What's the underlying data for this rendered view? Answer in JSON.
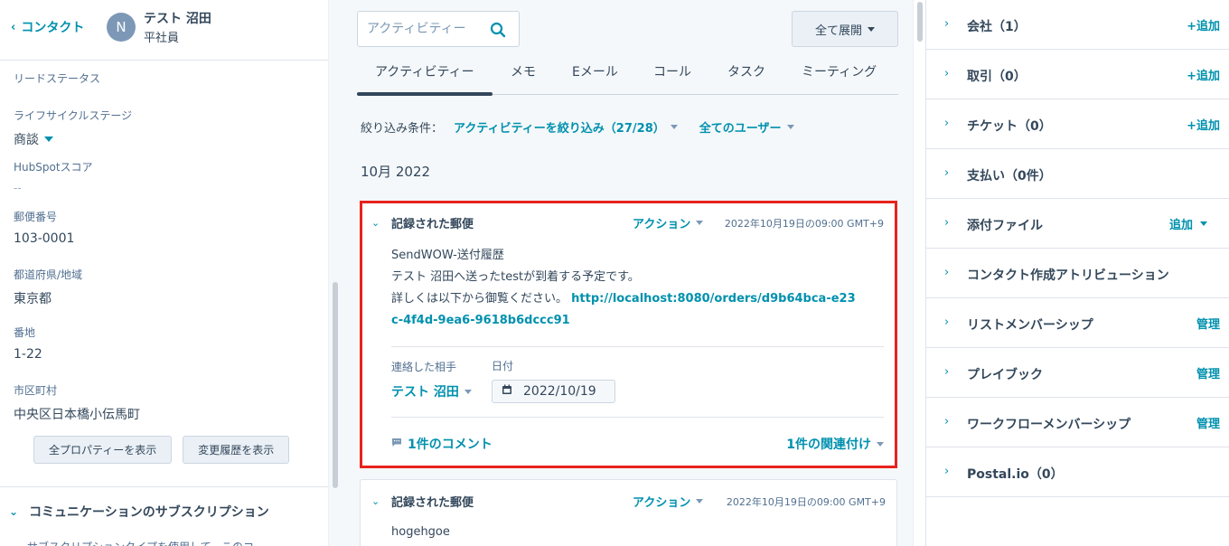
{
  "contact": {
    "back_label": "コンタクト",
    "avatar_initial": "N",
    "name": "テスト 沼田",
    "role": "平社員"
  },
  "properties": [
    {
      "label": "リードステータス",
      "value": ""
    },
    {
      "label": "ライフサイクルステージ",
      "value": "商談"
    },
    {
      "label": "HubSpotスコア",
      "value": "--"
    },
    {
      "label": "郵便番号",
      "value": "103-0001"
    },
    {
      "label": "都道府県/地域",
      "value": "東京都"
    },
    {
      "label": "番地",
      "value": "1-22"
    },
    {
      "label": "市区町村",
      "value": "中央区日本橋小伝馬町"
    }
  ],
  "left_buttons": {
    "all_props": "全プロパティーを表示",
    "history": "変更履歴を表示"
  },
  "subscription_section": {
    "title": "コミュニケーションのサブスクリプション",
    "cut_text": "サブスクリプションタイプを使用して、このコ"
  },
  "activity": {
    "search_placeholder": "アクティビティー",
    "expand_all": "全て展開",
    "tabs": [
      "アクティビティー",
      "メモ",
      "Eメール",
      "コール",
      "タスク",
      "ミーティング"
    ],
    "filter_label": "絞り込み条件：",
    "filter_activity": "アクティビティーを絞り込み（27/28）",
    "filter_users": "全てのユーザー",
    "month": "10月 2022"
  },
  "cards": [
    {
      "title": "記録された郵便",
      "action": "アクション",
      "date": "2022年10月19日の09:00 GMT+9",
      "line1": "SendWOW-送付履歴",
      "line2": "テスト 沼田へ送ったtestが到着する予定です。",
      "line3_prefix": "詳しくは以下から御覧ください。",
      "link": "http://localhost:8080/orders/d9b64bca-e23c-4f4d-9ea6-9618b6dccc91",
      "contact_label": "連絡した相手",
      "date_label": "日付",
      "contact_value": "テスト 沼田",
      "date_value": "2022/10/19",
      "comments": "1件のコメント",
      "associations": "1件の関連付け"
    },
    {
      "title": "記録された郵便",
      "action": "アクション",
      "date": "2022年10月19日の09:00 GMT+9",
      "line1": "hogehgoe"
    }
  ],
  "right_panel": [
    {
      "title": "会社（1）",
      "action": "+追加"
    },
    {
      "title": "取引（0）",
      "action": "+追加"
    },
    {
      "title": "チケット（0）",
      "action": "+追加"
    },
    {
      "title": "支払い（0件）",
      "action": ""
    },
    {
      "title": "添付ファイル",
      "action": "追加"
    },
    {
      "title": "コンタクト作成アトリビューション",
      "action": ""
    },
    {
      "title": "リストメンバーシップ",
      "action": "管理"
    },
    {
      "title": "プレイブック",
      "action": "管理"
    },
    {
      "title": "ワークフローメンバーシップ",
      "action": "管理"
    },
    {
      "title": "Postal.io（0）",
      "action": ""
    }
  ],
  "colors": {
    "accent": "#0091ae",
    "text": "#33475b",
    "highlight_border": "#e8231d"
  }
}
